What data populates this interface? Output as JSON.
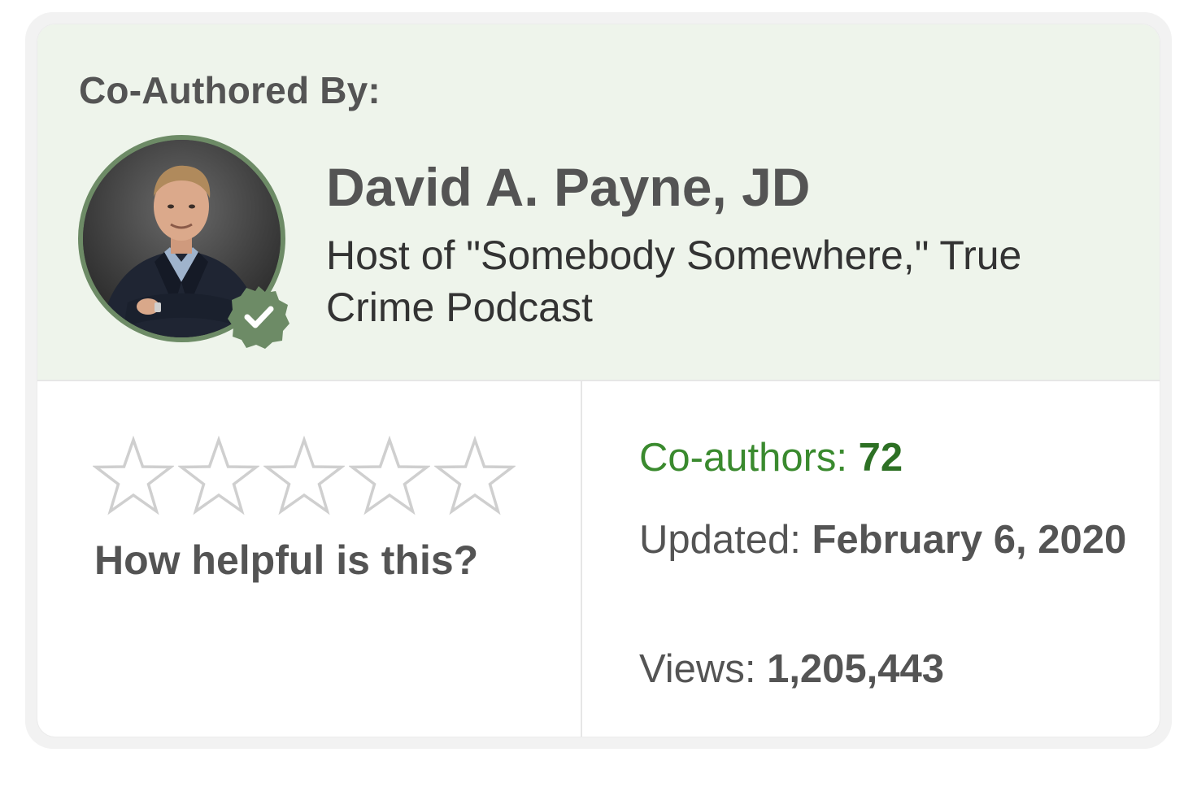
{
  "card": {
    "coauthored_label": "Co-Authored By:",
    "author": {
      "name": "David A. Payne, JD",
      "title": "Host of \"Somebody Somewhere,\" True Crime Podcast",
      "avatar": "author-photo",
      "badge_icon": "verified-check-icon"
    }
  },
  "rating": {
    "stars_total": 5,
    "stars_filled": 0,
    "prompt": "How helpful is this?"
  },
  "stats": {
    "coauthors_label": "Co-authors: ",
    "coauthors_value": "72",
    "updated_label": "Updated: ",
    "updated_value": "February 6, 2020",
    "views_label": "Views: ",
    "views_value": "1,205,443"
  },
  "colors": {
    "header_bg": "#eef4eb",
    "accent_green": "#6d8b66",
    "coauthors_green": "#2d7024",
    "text_gray": "#545454"
  }
}
